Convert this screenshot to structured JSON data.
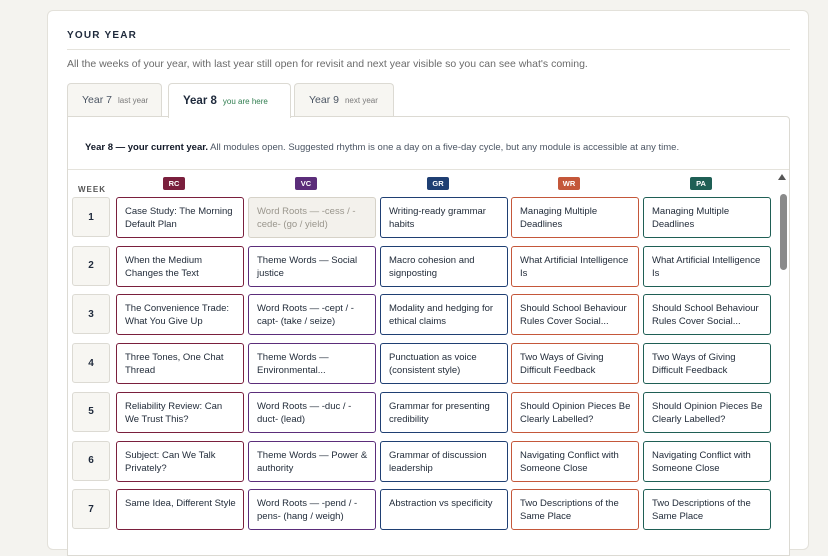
{
  "header": {
    "title": "YOUR YEAR",
    "subtitle": "All the weeks of your year, with last year still open for revisit and next year visible so you can see what's coming."
  },
  "tabs": [
    {
      "name": "Year 7",
      "note": "last year",
      "active": false
    },
    {
      "name": "Year 8",
      "note": "you are here",
      "active": true
    },
    {
      "name": "Year 9",
      "note": "next year",
      "active": false
    }
  ],
  "intro": {
    "bold": "Year 8 — your current year.",
    "rest": " All modules open. Suggested rhythm is one a day on a five-day cycle, but any module is accessible at any time."
  },
  "grid": {
    "week_label": "WEEK",
    "columns": [
      {
        "code": "RC",
        "color": "#7a1f3d"
      },
      {
        "code": "VC",
        "color": "#5b2d7a"
      },
      {
        "code": "GR",
        "color": "#1f3f73"
      },
      {
        "code": "WR",
        "color": "#c4573a"
      },
      {
        "code": "PA",
        "color": "#1f5f55"
      }
    ],
    "rows": [
      {
        "week": "1",
        "cells": [
          "Case Study: The Morning Default Plan",
          "Word Roots — -cess / -cede- (go / yield)",
          "Writing-ready grammar habits",
          "Managing Multiple Deadlines",
          "Managing Multiple Deadlines"
        ]
      },
      {
        "week": "2",
        "cells": [
          "When the Medium Changes the Text",
          "Theme Words — Social justice",
          "Macro cohesion and signposting",
          "What Artificial Intelligence Is",
          "What Artificial Intelligence Is"
        ]
      },
      {
        "week": "3",
        "cells": [
          "The Convenience Trade: What You Give Up",
          "Word Roots — -cept / -capt- (take / seize)",
          "Modality and hedging for ethical claims",
          "Should School Behaviour Rules Cover Social...",
          "Should School Behaviour Rules Cover Social..."
        ]
      },
      {
        "week": "4",
        "cells": [
          "Three Tones, One Chat Thread",
          "Theme Words — Environmental...",
          "Punctuation as voice (consistent style)",
          "Two Ways of Giving Difficult Feedback",
          "Two Ways of Giving Difficult Feedback"
        ]
      },
      {
        "week": "5",
        "cells": [
          "Reliability Review: Can We Trust This?",
          "Word Roots — -duc / -duct- (lead)",
          "Grammar for presenting credibility",
          "Should Opinion Pieces Be Clearly Labelled?",
          "Should Opinion Pieces Be Clearly Labelled?"
        ]
      },
      {
        "week": "6",
        "cells": [
          "Subject: Can We Talk Privately?",
          "Theme Words — Power & authority",
          "Grammar of discussion leadership",
          "Navigating Conflict with Someone Close",
          "Navigating Conflict with Someone Close"
        ]
      },
      {
        "week": "7",
        "cells": [
          "Same Idea, Different Style",
          "Word Roots — -pend / -pens- (hang / weigh)",
          "Abstraction vs specificity",
          "Two Descriptions of the Same Place",
          "Two Descriptions of the Same Place"
        ]
      }
    ]
  }
}
